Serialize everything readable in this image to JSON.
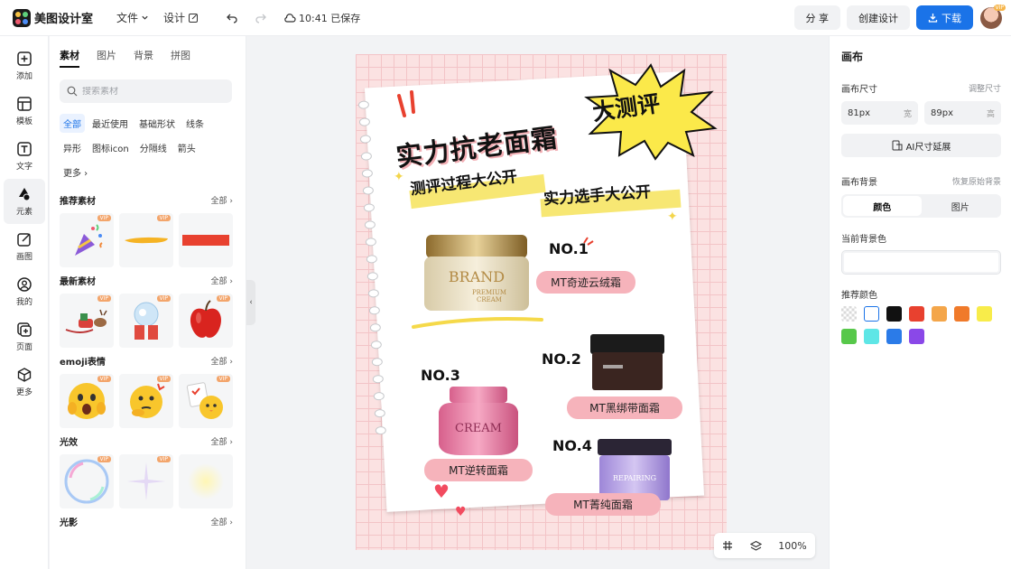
{
  "app": {
    "name": "美图设计室"
  },
  "menu": {
    "file": "文件",
    "design": "设计",
    "save_status": "10:41 已保存"
  },
  "top_buttons": {
    "share": "分 享",
    "create": "创建设计",
    "download": "下载",
    "vip": "VIP"
  },
  "rail": [
    {
      "label": "添加",
      "icon": "plus-square-icon"
    },
    {
      "label": "模板",
      "icon": "template-icon"
    },
    {
      "label": "文字",
      "icon": "text-icon"
    },
    {
      "label": "元素",
      "icon": "shapes-icon"
    },
    {
      "label": "画图",
      "icon": "draw-icon"
    },
    {
      "label": "我的",
      "icon": "user-icon"
    },
    {
      "label": "页面",
      "icon": "page-add-icon"
    },
    {
      "label": "更多",
      "icon": "cube-icon"
    }
  ],
  "panel": {
    "tabs": [
      "素材",
      "图片",
      "背景",
      "拼图"
    ],
    "search_placeholder": "搜索素材",
    "chips": [
      "全部",
      "最近使用",
      "基础形状",
      "线条",
      "异形",
      "图标icon",
      "分隔线",
      "箭头",
      "更多"
    ],
    "all_label": "全部",
    "vip": "VIP",
    "sections": [
      "推荐素材",
      "最新素材",
      "emoji表情",
      "光效",
      "光影"
    ]
  },
  "poster": {
    "title": "实力抗老面霜",
    "burst_title": "大测评",
    "sub1": "测评过程大公开",
    "sub2": "实力选手大公开",
    "brand": "BRAND",
    "brand_sub": "PREMIUM",
    "brand_sub2": "CREAM",
    "cream": "CREAM",
    "repairing": "REPAIRING",
    "items": [
      {
        "no": "NO.1",
        "name": "MT奇迹云绒霜"
      },
      {
        "no": "NO.2",
        "name": "MT黑绑带面霜"
      },
      {
        "no": "NO.3",
        "name": "MT逆转面霜"
      },
      {
        "no": "NO.4",
        "name": "MT菁纯面霜"
      }
    ]
  },
  "zoom": "100%",
  "right_panel": {
    "title": "画布",
    "size_label": "画布尺寸",
    "adjust_size": "调整尺寸",
    "width_value": "81px",
    "width_unit": "宽",
    "height_value": "89px",
    "height_unit": "高",
    "ai_expand": "AI尺寸延展",
    "bg_label": "画布背景",
    "restore_bg": "恢复原始背景",
    "seg_color": "颜色",
    "seg_image": "图片",
    "current_bg": "当前背景色",
    "recommended": "推荐颜色",
    "swatches": [
      "transparent",
      "#ffffff",
      "#111111",
      "#e8412f",
      "#f4a64a",
      "#f07a2a",
      "#f8ec4a",
      "#57c84a",
      "#5ee6e6",
      "#2b7be8",
      "#8a48e8"
    ]
  }
}
